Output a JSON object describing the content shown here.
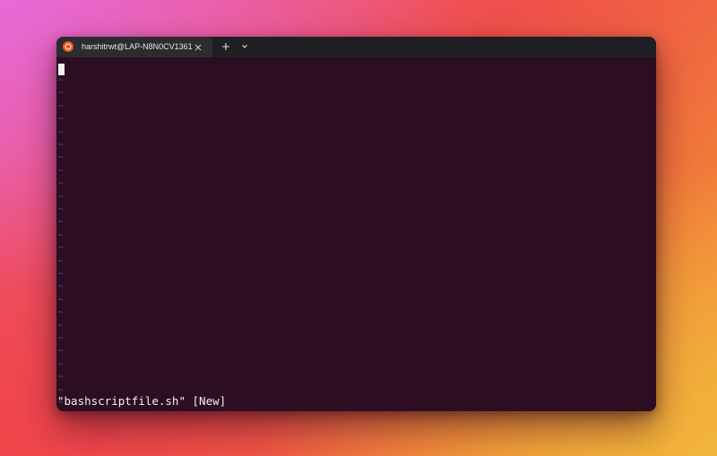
{
  "tab": {
    "title": "harshitrwt@LAP-N8N0CV1361",
    "icon": "ubuntu-logo-icon",
    "close_icon": "close-icon"
  },
  "toolbar": {
    "new_tab_icon": "plus-icon",
    "dropdown_icon": "chevron-down-icon"
  },
  "editor": {
    "empty_line_marker": "~",
    "empty_line_count": 26,
    "status_message": "\"bashscriptfile.sh\" [New]"
  },
  "colors": {
    "terminal_bg": "#2c0d22",
    "titlebar_bg": "#1f1f23",
    "tab_bg": "#2c2c30",
    "tilde": "#3f5fd6",
    "ubuntu_orange": "#e9541f"
  }
}
